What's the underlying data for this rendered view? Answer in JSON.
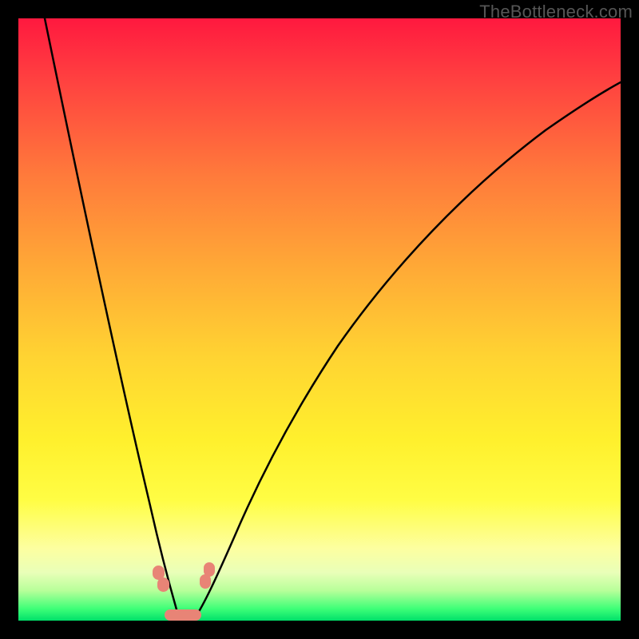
{
  "watermark": "TheBottleneck.com",
  "chart_data": {
    "type": "line",
    "title": "",
    "xlabel": "",
    "ylabel": "",
    "xlim": [
      0,
      100
    ],
    "ylim": [
      0,
      100
    ],
    "series": [
      {
        "name": "bottleneck-curve",
        "x": [
          4,
          8,
          12,
          16,
          20,
          22,
          24,
          25,
          26,
          27,
          28,
          30,
          34,
          40,
          48,
          56,
          64,
          74,
          84,
          94,
          100
        ],
        "values": [
          100,
          83,
          66,
          48,
          27,
          16,
          7,
          3,
          1,
          0,
          1,
          4,
          12,
          24,
          38,
          50,
          60,
          70,
          79,
          86,
          90
        ]
      }
    ],
    "markers": [
      {
        "name": "left-dot-pair",
        "x": 23.5,
        "y": 6
      },
      {
        "name": "right-dot-pair",
        "x": 31,
        "y": 6
      },
      {
        "name": "bottom-bar",
        "x": 27,
        "y": 0.5
      }
    ],
    "colors": {
      "gradient_top": "#ff193f",
      "gradient_bottom": "#00e06a",
      "marker": "#e88476",
      "curve": "#000000"
    }
  }
}
